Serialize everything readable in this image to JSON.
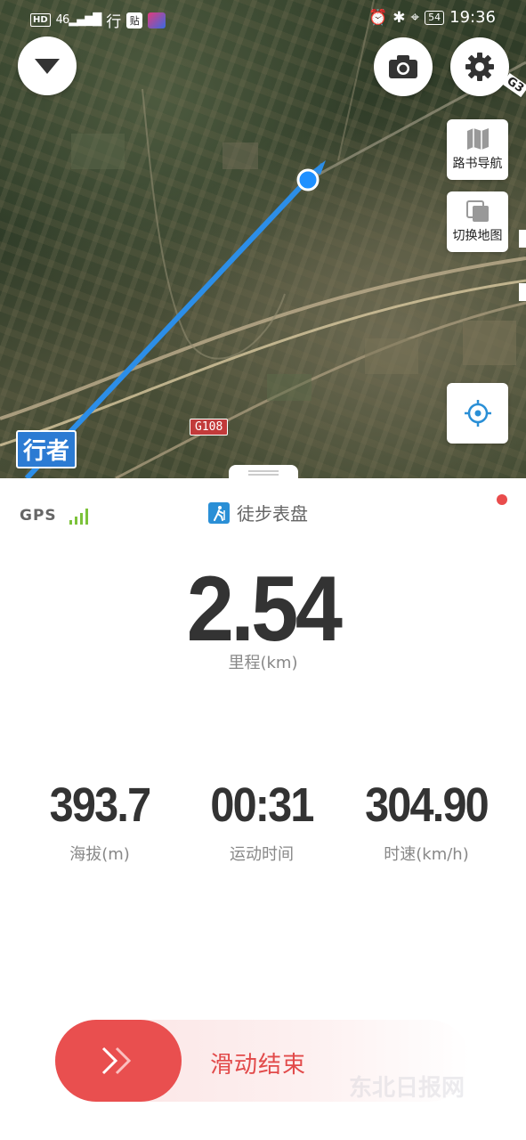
{
  "status_bar": {
    "hd": "HD",
    "network": "46",
    "app1": "行",
    "app2": "贴",
    "battery": "54",
    "time": "19:36"
  },
  "map": {
    "road_label": "G108",
    "road_label_edge": "G3",
    "position_tag": "行者",
    "buttons": {
      "roadbook": "路书导航",
      "switch_map": "切换地图"
    }
  },
  "panel": {
    "gps_label": "GPS",
    "mode_label": "徒步表盘",
    "distance_value": "2.54",
    "distance_label": "里程(km)",
    "stats": [
      {
        "value": "393.7",
        "label": "海拔(m)"
      },
      {
        "value": "00:31",
        "label": "运动时间"
      },
      {
        "value": "304.90",
        "label": "时速(km/h)"
      }
    ],
    "slider_label": "滑动结束",
    "watermark": "东北日报网"
  },
  "colors": {
    "accent_red": "#e94f4f",
    "track_blue": "#2c8ee8",
    "gps_green": "#7cc23a"
  }
}
